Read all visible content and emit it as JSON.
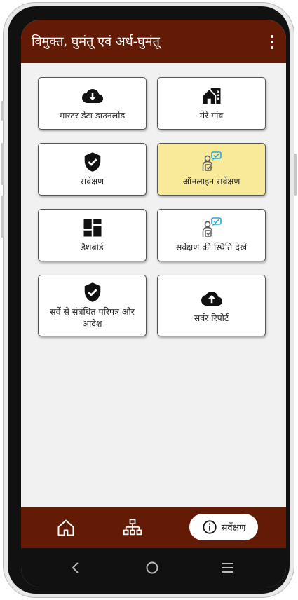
{
  "appbar": {
    "title": "विमुक्त, घुमंतू एवं अर्ध-घुमंतू"
  },
  "tiles": [
    {
      "label": "मास्टर डेटा डाउनलोड",
      "icon": "cloud-download-icon"
    },
    {
      "label": "मेरे गांव",
      "icon": "village-home-icon"
    },
    {
      "label": "सर्वेक्षण",
      "icon": "shield-check-icon"
    },
    {
      "label": "ऑनलाइन सर्वेक्षण",
      "icon": "online-survey-person-icon",
      "selected": true
    },
    {
      "label": "डैशबोर्ड",
      "icon": "dashboard-icon"
    },
    {
      "label": "सर्वेक्षण की स्थिति देखें",
      "icon": "survey-status-person-icon"
    },
    {
      "label": "सर्वे से संबंधित परिपत्र और आदेश",
      "icon": "shield-check-icon"
    },
    {
      "label": "सर्वर रिपोर्ट",
      "icon": "cloud-upload-icon"
    }
  ],
  "bottom_nav": {
    "active_label": "सर्वेक्षण",
    "items": [
      "home-icon",
      "sitemap-icon",
      "info-icon"
    ]
  },
  "colors": {
    "primary": "#641b06",
    "selected_tile": "#f9ea9a",
    "accent_blue": "#2aa5d8"
  }
}
